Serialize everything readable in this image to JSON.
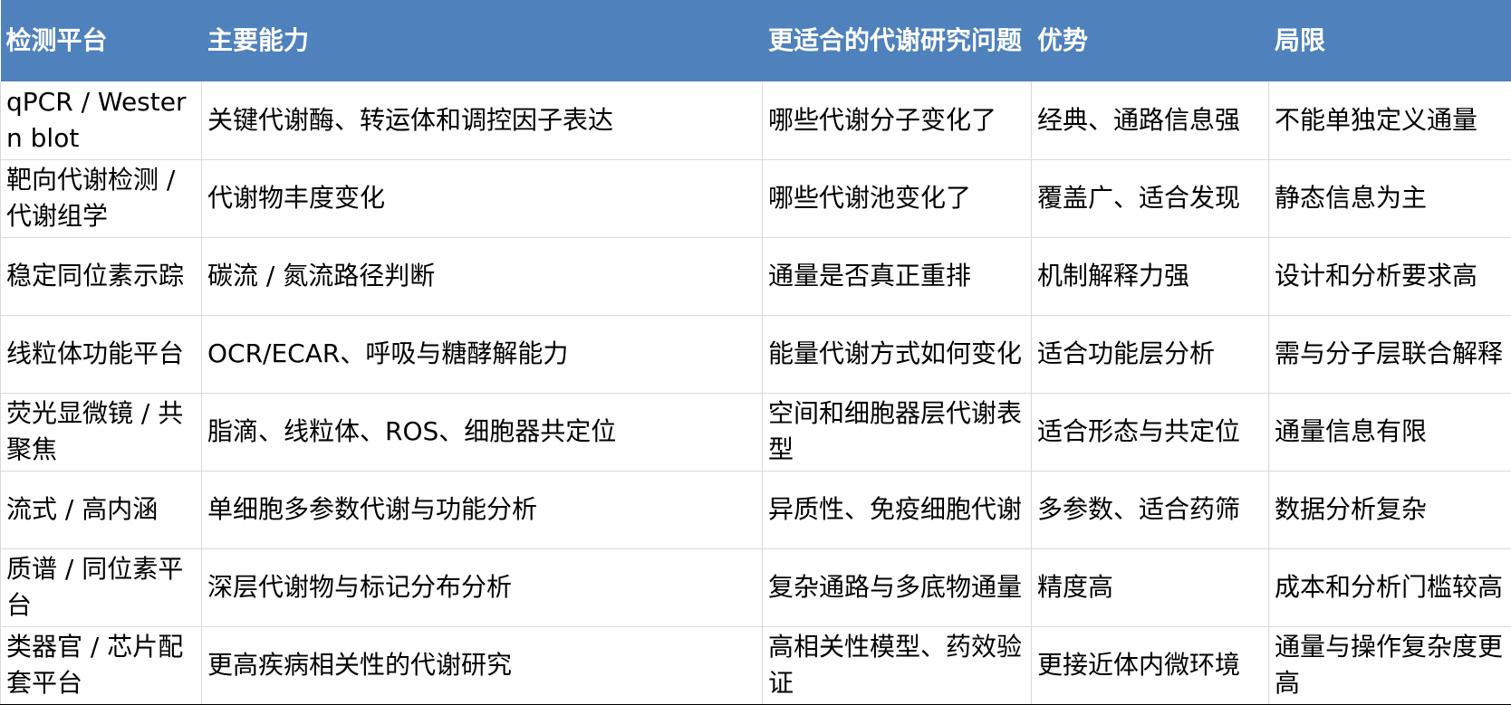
{
  "table": {
    "headers": [
      "检测平台",
      "主要能力",
      "更适合的代谢研究问题",
      "优势",
      "局限"
    ],
    "rows": [
      [
        "qPCR / Western blot",
        "关键代谢酶、转运体和调控因子表达",
        "哪些代谢分子变化了",
        "经典、通路信息强",
        "不能单独定义通量"
      ],
      [
        "靶向代谢检测 / 代谢组学",
        "代谢物丰度变化",
        "哪些代谢池变化了",
        "覆盖广、适合发现",
        "静态信息为主"
      ],
      [
        "稳定同位素示踪",
        "碳流 / 氮流路径判断",
        "通量是否真正重排",
        "机制解释力强",
        "设计和分析要求高"
      ],
      [
        "线粒体功能平台",
        "OCR/ECAR、呼吸与糖酵解能力",
        "能量代谢方式如何变化",
        "适合功能层分析",
        "需与分子层联合解释"
      ],
      [
        "荧光显微镜 / 共聚焦",
        "脂滴、线粒体、ROS、细胞器共定位",
        "空间和细胞器层代谢表型",
        "适合形态与共定位",
        "通量信息有限"
      ],
      [
        "流式 / 高内涵",
        "单细胞多参数代谢与功能分析",
        "异质性、免疫细胞代谢",
        "多参数、适合药筛",
        "数据分析复杂"
      ],
      [
        "质谱 / 同位素平台",
        "深层代谢物与标记分布分析",
        "复杂通路与多底物通量",
        "精度高",
        "成本和分析门槛较高"
      ],
      [
        "类器官 / 芯片配套平台",
        "更高疾病相关性的代谢研究",
        "高相关性模型、药效验证",
        "更接近体内微环境",
        "通量与操作复杂度更高"
      ]
    ]
  },
  "colors": {
    "header_bg": "#4f81bd",
    "header_text": "#ffffff",
    "grid_line": "#d9d9d9"
  }
}
